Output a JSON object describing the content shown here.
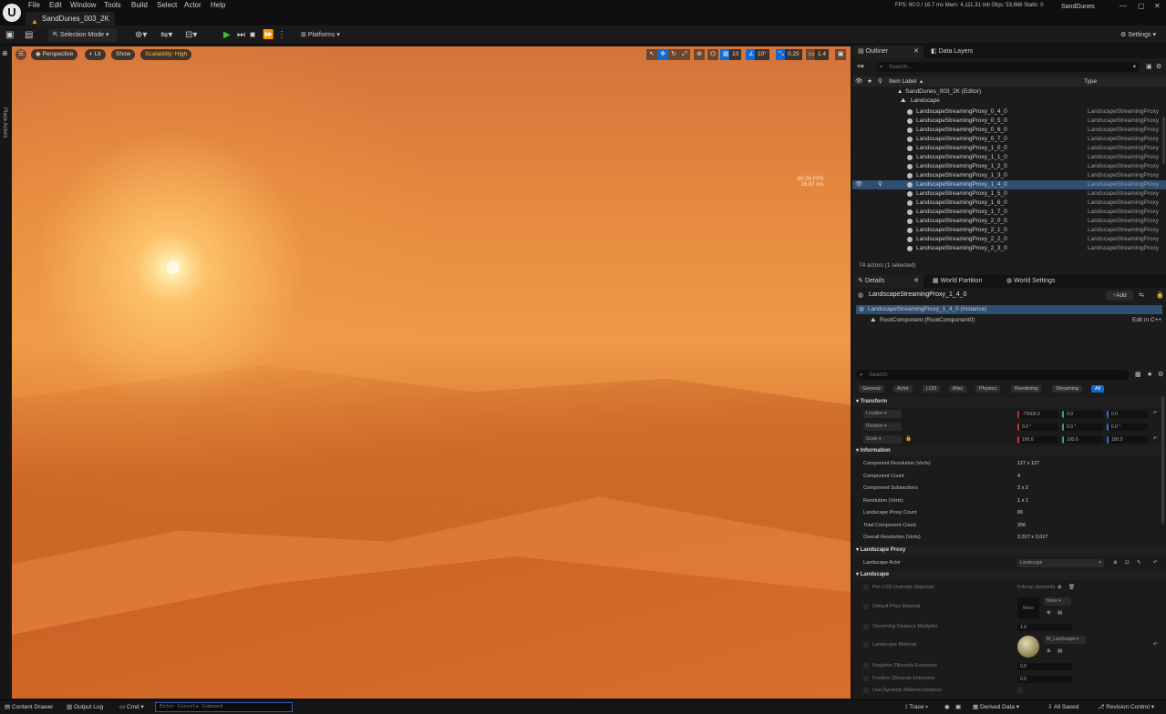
{
  "menu": [
    "File",
    "Edit",
    "Window",
    "Tools",
    "Build",
    "Select",
    "Actor",
    "Help"
  ],
  "doc_tab": "SandDunes_003_2K",
  "stats": "FPS: 60.0 / 16.7 ms   Mem: 4,111.31 mb   Objs: 53,866   Stalls: 0",
  "project_name": "SandDunes",
  "toolbar": {
    "selection_mode": "Selection Mode",
    "platforms": "Platforms",
    "settings": "Settings"
  },
  "left_strip": {
    "place_actors": "Place Actors"
  },
  "viewport": {
    "perspective": "Perspective",
    "lit": "Lit",
    "show": "Show",
    "scalability": "Scalability: High",
    "grid_snap": "10",
    "rot_snap": "10°",
    "scale_snap": "0.25",
    "cam_speed": "1.4",
    "fps_line1": "60.00 FPS",
    "fps_line2": "16.67 ms"
  },
  "outliner": {
    "tab": "Outliner",
    "tab2": "Data Layers",
    "search_placeholder": "Search...",
    "col_label": "Item Label",
    "col_type": "Type",
    "root": "SandDunes_003_2K (Editor)",
    "landscape": "Landscape",
    "rows": [
      {
        "label": "LandscapeStreamingProxy_0_4_0",
        "type": "LandscapeStreamingProxy"
      },
      {
        "label": "LandscapeStreamingProxy_0_5_0",
        "type": "LandscapeStreamingProxy"
      },
      {
        "label": "LandscapeStreamingProxy_0_6_0",
        "type": "LandscapeStreamingProxy"
      },
      {
        "label": "LandscapeStreamingProxy_0_7_0",
        "type": "LandscapeStreamingProxy"
      },
      {
        "label": "LandscapeStreamingProxy_1_0_0",
        "type": "LandscapeStreamingProxy"
      },
      {
        "label": "LandscapeStreamingProxy_1_1_0",
        "type": "LandscapeStreamingProxy"
      },
      {
        "label": "LandscapeStreamingProxy_1_2_0",
        "type": "LandscapeStreamingProxy"
      },
      {
        "label": "LandscapeStreamingProxy_1_3_0",
        "type": "LandscapeStreamingProxy"
      },
      {
        "label": "LandscapeStreamingProxy_1_4_0",
        "type": "LandscapeStreamingProxy"
      },
      {
        "label": "LandscapeStreamingProxy_1_5_0",
        "type": "LandscapeStreamingProxy"
      },
      {
        "label": "LandscapeStreamingProxy_1_6_0",
        "type": "LandscapeStreamingProxy"
      },
      {
        "label": "LandscapeStreamingProxy_1_7_0",
        "type": "LandscapeStreamingProxy"
      },
      {
        "label": "LandscapeStreamingProxy_2_0_0",
        "type": "LandscapeStreamingProxy"
      },
      {
        "label": "LandscapeStreamingProxy_2_1_0",
        "type": "LandscapeStreamingProxy"
      },
      {
        "label": "LandscapeStreamingProxy_2_2_0",
        "type": "LandscapeStreamingProxy"
      },
      {
        "label": "LandscapeStreamingProxy_2_3_0",
        "type": "LandscapeStreamingProxy"
      }
    ],
    "status": "74 actors (1 selected)"
  },
  "details": {
    "tab": "Details",
    "tab2": "World Partition",
    "tab3": "World Settings",
    "actor_name": "LandscapeStreamingProxy_1_4_0",
    "add": "Add",
    "instance": "LandscapeStreamingProxy_1_4_0 (Instance)",
    "root_component": "RootComponent (RootComponent0)",
    "edit_cpp": "Edit in C++",
    "search_placeholder": "Search",
    "filters": [
      "General",
      "Actor",
      "LOD",
      "Misc",
      "Physics",
      "Rendering",
      "Streaming",
      "All"
    ],
    "transform": {
      "title": "Transform",
      "location": "Location",
      "rotation": "Rotation",
      "scale": "Scale",
      "loc_values": [
        "-75600.0",
        "0.0",
        "0.0"
      ],
      "rot_values": [
        "0.0 °",
        "0.0 °",
        "0.0 °"
      ],
      "scale_values": [
        "100.0",
        "100.0",
        "100.0"
      ]
    },
    "information": {
      "title": "Information",
      "props": [
        {
          "k": "Component Resolution (Verts)",
          "v": "127 x 127"
        },
        {
          "k": "Component Count",
          "v": "4"
        },
        {
          "k": "Component Subsections",
          "v": "2 x 2"
        },
        {
          "k": "Resolution (Verts)",
          "v": "1 x 1"
        },
        {
          "k": "Landscape Proxy Count",
          "v": "65"
        },
        {
          "k": "Total Component Count",
          "v": "256"
        },
        {
          "k": "Overall Resolution (Verts)",
          "v": "2,017 x 2,017"
        }
      ]
    },
    "landscape_proxy": {
      "title": "Landscape Proxy",
      "actor_label": "Landscape Actor",
      "actor_value": "Landscape"
    },
    "landscape": {
      "title": "Landscape",
      "lod_override": "Per LOD Override Materials",
      "lod_override_val": "0 Array elements",
      "default_phys": "Default Phys Material",
      "phys_none": "None",
      "phys_dd": "None",
      "stream_dist": "Streaming Distance Multiplier",
      "stream_val": "1.0",
      "material": "Landscape Material",
      "material_val": "M_Landscape",
      "neg_z": "Negative ZBounds Extension",
      "neg_z_val": "0.0",
      "pos_z": "Positive ZBounds Extension",
      "pos_z_val": "0.0",
      "dyn_mat": "Use Dynamic Material Instance"
    }
  },
  "bottom": {
    "content_drawer": "Content Drawer",
    "output_log": "Output Log",
    "cmd": "Cmd",
    "console_placeholder": "Enter Console Command",
    "trace": "Trace",
    "derived_data": "Derived Data",
    "all_saved": "All Saved",
    "revision_control": "Revision Control"
  },
  "colors": {
    "accent": "#0f6ad6",
    "selection": "#2f4f72",
    "sky": "#e68a3f"
  }
}
